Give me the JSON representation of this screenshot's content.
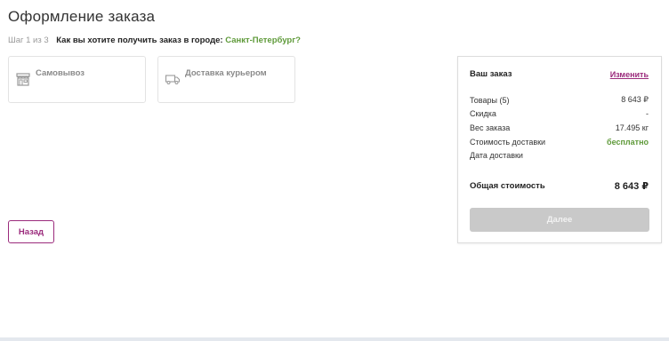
{
  "page": {
    "title": "Оформление заказа",
    "step": "Шаг 1 из 3",
    "question": "Как вы хотите получить заказ в городе: ",
    "city": "Санкт-Петербург?"
  },
  "delivery_options": [
    {
      "label": "Самовывоз",
      "icon": "store-icon"
    },
    {
      "label": "Доставка курьером",
      "icon": "truck-icon"
    }
  ],
  "back_button": "Назад",
  "summary": {
    "title": "Ваш заказ",
    "edit_link": "Изменить",
    "rows": [
      {
        "label": "Товары (5)",
        "value": "8 643 ₽"
      },
      {
        "label": "Скидка",
        "value": "-"
      },
      {
        "label": "Вес заказа",
        "value": "17.495 кг"
      },
      {
        "label": "Стоимость доставки",
        "value": "бесплатно"
      },
      {
        "label": "Дата доставки",
        "value": ""
      }
    ],
    "total_label": "Общая стоимость",
    "total_value": "8 643 ₽",
    "next_button": "Далее"
  },
  "colors": {
    "accent": "#9b2b7c",
    "green": "#5f9a3a",
    "disabled_button": "#c9c9c9"
  }
}
